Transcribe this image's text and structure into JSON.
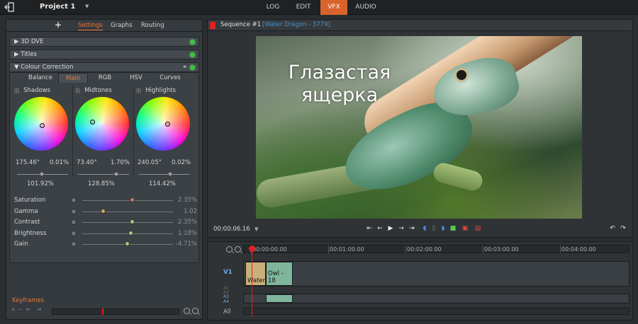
{
  "app": {
    "project_title": "Project 1",
    "mode_tabs": [
      "LOG",
      "EDIT",
      "VFX",
      "AUDIO"
    ],
    "active_mode": "VFX"
  },
  "left_panel": {
    "add_label": "+",
    "tabs": [
      "Settings",
      "Graphs",
      "Routing"
    ],
    "active_tab": "Settings",
    "effects": [
      {
        "label": "▶ 3D DVE"
      },
      {
        "label": "▶ Titles"
      },
      {
        "label": "▼ Colour Correction"
      }
    ],
    "cc_tabs": [
      "Balance",
      "Main",
      "RGB",
      "HSV",
      "Curves"
    ],
    "cc_active": "Main",
    "wheels": [
      {
        "name": "Shadows",
        "hue": "175.46°",
        "sat": "0.01%",
        "level": "101.92%"
      },
      {
        "name": "Midtones",
        "hue": "73.40°",
        "sat": "1.70%",
        "level": "128.85%"
      },
      {
        "name": "Highlights",
        "hue": "240.05°",
        "sat": "0.02%",
        "level": "114.42%"
      }
    ],
    "params": [
      {
        "label": "Saturation",
        "value": "2.35%",
        "level": 0.55,
        "knob_color": "#c97a6a"
      },
      {
        "label": "Gamma",
        "value": "1.02",
        "level": 0.23,
        "knob_color": "#c9a86a"
      },
      {
        "label": "Contrast",
        "value": "2.35%",
        "level": 0.55,
        "knob_color": "#a8c97a"
      },
      {
        "label": "Brightness",
        "value": "1.18%",
        "level": 0.53,
        "knob_color": "#a8c97a"
      },
      {
        "label": "Gain",
        "value": "-4.71%",
        "level": 0.49,
        "knob_color": "#a8c97a"
      }
    ],
    "keyframes_label": "Keyframes"
  },
  "viewer": {
    "sequence_label": "Sequence #1",
    "clip_label": "[Water Dragon - 3779]",
    "caption_line1": "Глазастая",
    "caption_line2": "ящерка",
    "timecode": "00:00:06.16"
  },
  "timeline": {
    "ticks": [
      "00:00:00.00",
      "00:01:00.00",
      "00:02:00.00",
      "00:03:00.00",
      "00:04:00.00"
    ],
    "video_track_label": "V1",
    "a3_label": "A3",
    "a4_label": "A4",
    "all_label": "All",
    "clips": [
      {
        "label": "Water",
        "color": "#c9b07a"
      },
      {
        "label": "Owl - 18",
        "color": "#7fb59a"
      }
    ]
  },
  "colors": {
    "accent": "#d9632b",
    "active_tab_text": "#e8783a",
    "link_blue": "#4a90c8",
    "enabled_dot": "#3fbf3f",
    "playhead": "#dd2222"
  }
}
